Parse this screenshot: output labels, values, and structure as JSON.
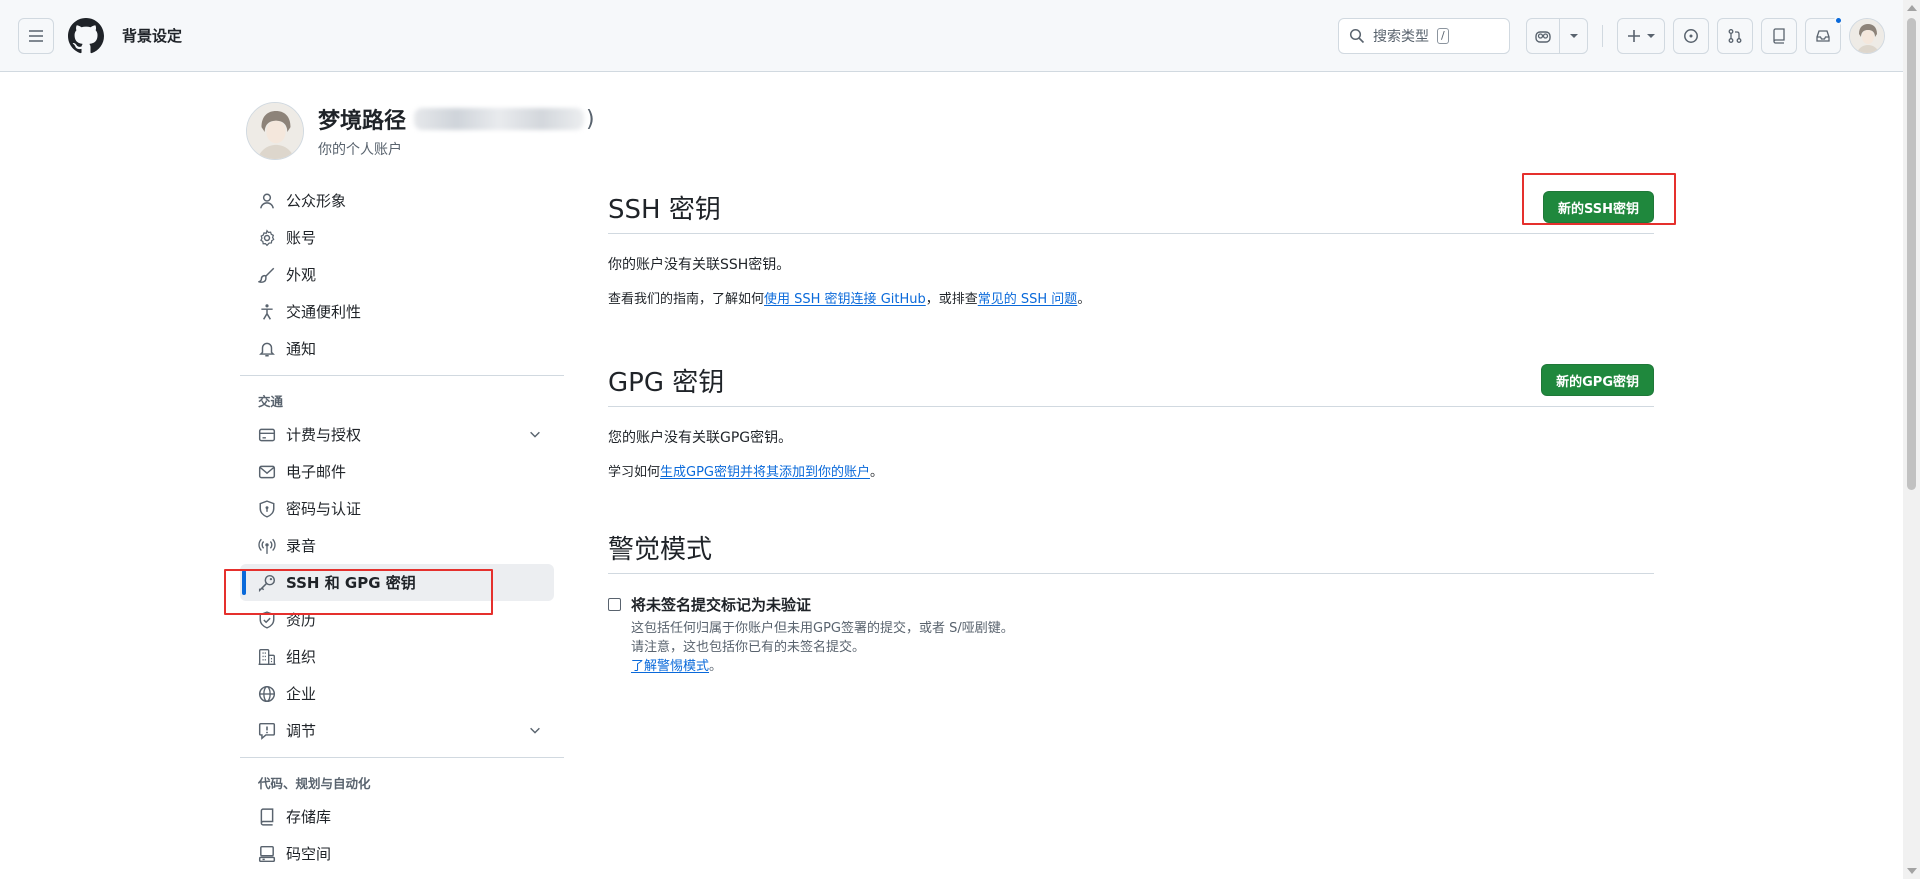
{
  "header": {
    "context_title": "背景设定",
    "search_placeholder": "搜索类型",
    "search_shortcut": "/"
  },
  "profile": {
    "display_name": "梦境路径",
    "username_suffix": ")",
    "subtitle": "你的个人账户"
  },
  "sidebar": {
    "items_top": [
      {
        "label": "公众形象",
        "icon": "person-icon"
      },
      {
        "label": "账号",
        "icon": "gear-icon"
      },
      {
        "label": "外观",
        "icon": "paintbrush-icon"
      },
      {
        "label": "交通便利性",
        "icon": "accessibility-icon"
      },
      {
        "label": "通知",
        "icon": "bell-icon"
      }
    ],
    "group_access_title": "交通",
    "items_access": [
      {
        "label": "计费与授权",
        "icon": "credit-card-icon",
        "expandable": true
      },
      {
        "label": "电子邮件",
        "icon": "mail-icon"
      },
      {
        "label": "密码与认证",
        "icon": "shield-lock-icon"
      },
      {
        "label": "录音",
        "icon": "broadcast-icon"
      },
      {
        "label": "SSH 和 GPG 密钥",
        "icon": "key-icon",
        "active": true
      },
      {
        "label": "资历",
        "icon": "shield-check-icon"
      },
      {
        "label": "组织",
        "icon": "organization-icon"
      },
      {
        "label": "企业",
        "icon": "globe-icon"
      },
      {
        "label": "调节",
        "icon": "report-icon",
        "expandable": true
      }
    ],
    "group_code_title": "代码、规划与自动化",
    "items_code": [
      {
        "label": "存储库",
        "icon": "repo-icon"
      },
      {
        "label": "码空间",
        "icon": "codespaces-icon"
      }
    ]
  },
  "ssh": {
    "title": "SSH 密钥",
    "new_button": "新的SSH密钥",
    "empty_text": "你的账户没有关联SSH密钥。",
    "help_prefix": "查看我们的指南，了解如何",
    "help_link1": "使用 SSH 密钥连接 GitHub",
    "help_middle": "，或排查",
    "help_link2": "常见的 SSH 问题",
    "help_suffix": "。"
  },
  "gpg": {
    "title": "GPG 密钥",
    "new_button": "新的GPG密钥",
    "empty_text": "您的账户没有关联GPG密钥。",
    "help_prefix": "学习如何",
    "help_link": "生成GPG密钥并将其添加到你的账户",
    "help_suffix": "。"
  },
  "vigilant": {
    "title": "警觉模式",
    "checkbox_label": "将未签名提交标记为未验证",
    "desc_line1": "这包括任何归属于你账户但未用GPG签署的提交，或者 S/哑剧键。",
    "desc_line2": "请注意，这也包括你已有的未签名提交。",
    "learn_link": "了解警惕模式",
    "learn_suffix": "。"
  },
  "colors": {
    "accent_blue": "#0969da",
    "button_green": "#1f883d",
    "highlight_red": "#e5302d"
  }
}
